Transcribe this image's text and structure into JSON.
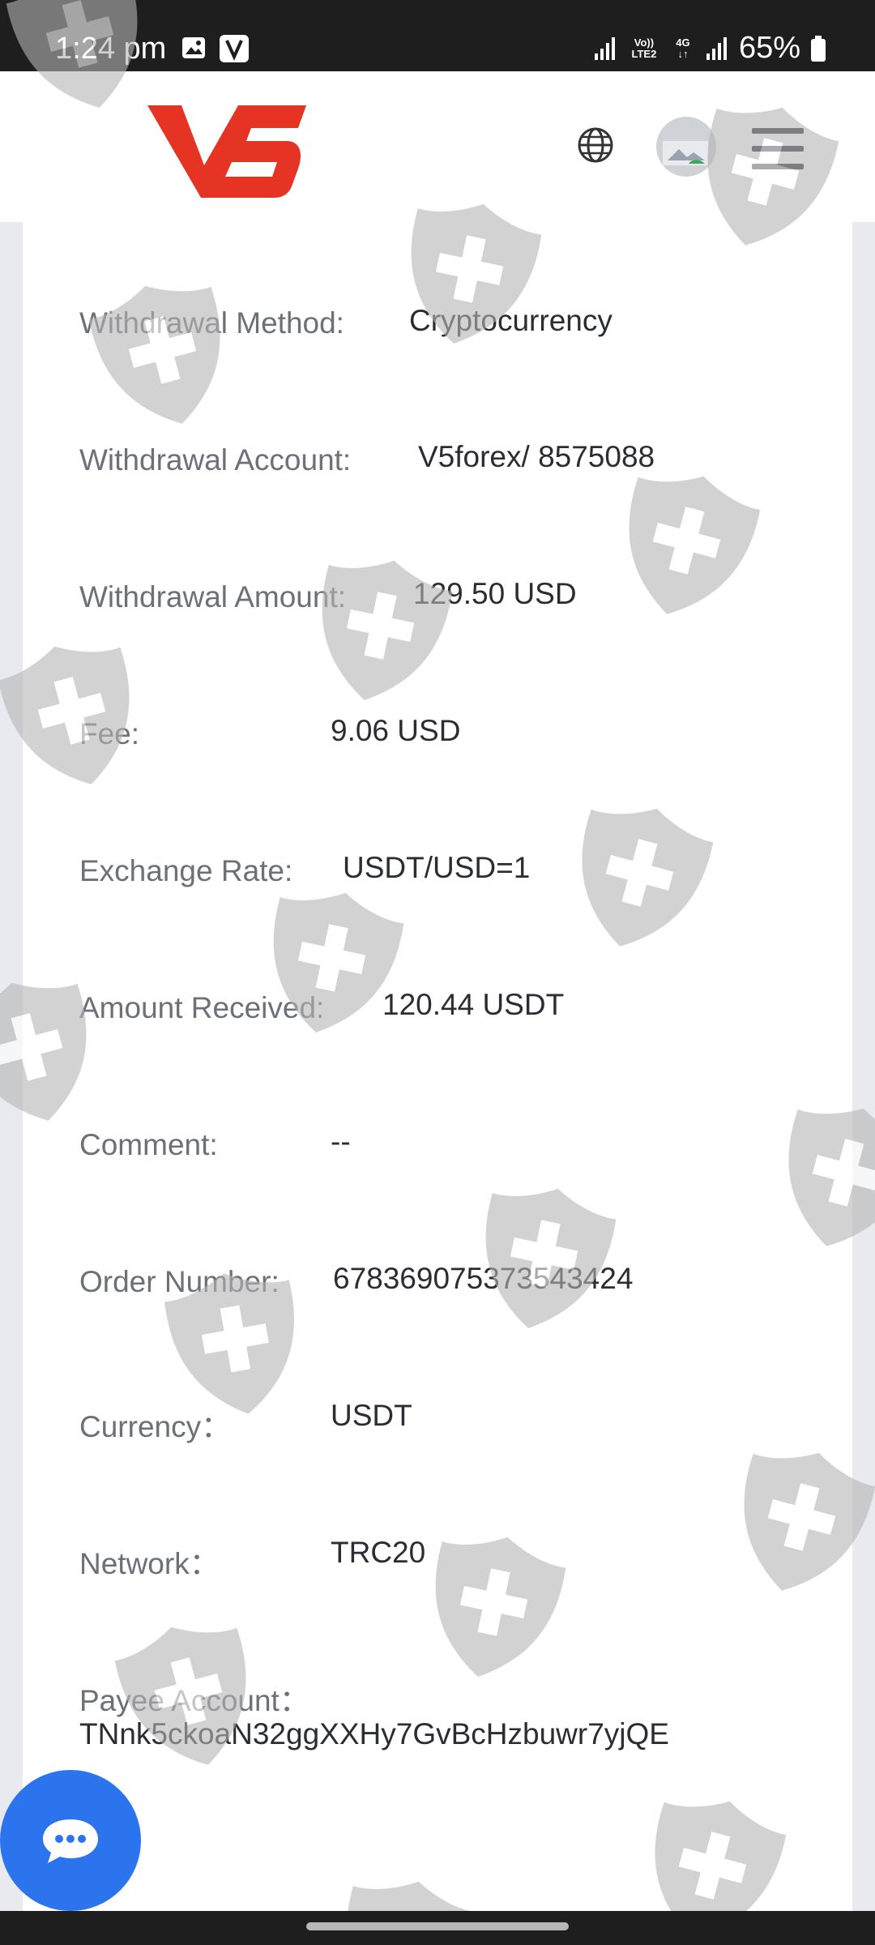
{
  "status_bar": {
    "time": "1:24 pm",
    "battery": "65%",
    "network_label_top": "Vo)) LTE2",
    "network_label_4g": "4G",
    "icons": [
      "image-icon",
      "v-app-icon",
      "signal-icon",
      "volte-icon",
      "4g-icon",
      "signal-icon",
      "battery-icon"
    ]
  },
  "header": {
    "logo_text": "V5",
    "brand_color": "#e53424",
    "icons": [
      "globe-icon",
      "avatar",
      "menu-icon"
    ]
  },
  "details": [
    {
      "label": "Withdrawal Method:",
      "value": "Cryptocurrency"
    },
    {
      "label": "Withdrawal Account:",
      "value": "V5forex/ 8575088"
    },
    {
      "label": "Withdrawal Amount:",
      "value": "129.50 USD"
    },
    {
      "label": "Fee:",
      "value": "9.06 USD"
    },
    {
      "label": "Exchange Rate:",
      "value": "USDT/USD=1"
    },
    {
      "label": "Amount Received:",
      "value": "120.44 USDT"
    },
    {
      "label": "Comment:",
      "value": "--"
    },
    {
      "label": "Order Number:",
      "value": "678369075373543424"
    },
    {
      "label": "Currency：",
      "value": "USDT"
    },
    {
      "label": "Network：",
      "value": "TRC20"
    },
    {
      "label": "Payee Account：",
      "value": "TNnk5ckoaN32ggXXHy7GvBcHzbuwr7yjQE"
    }
  ],
  "chat": {
    "icon": "chat-bubble-icon",
    "color": "#2c74ee"
  }
}
